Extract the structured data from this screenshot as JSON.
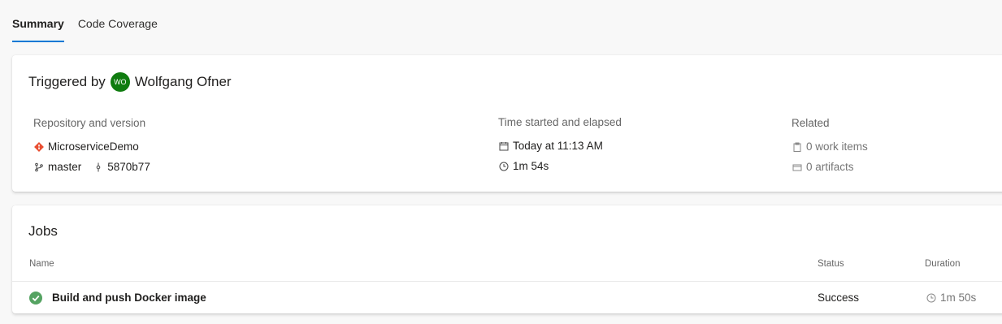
{
  "tabs": [
    {
      "label": "Summary",
      "active": true
    },
    {
      "label": "Code Coverage",
      "active": false
    }
  ],
  "summary": {
    "triggered_by_label": "Triggered by",
    "user_initials": "WO",
    "user_name": "Wolfgang Ofner",
    "avatar_color": "#107c10",
    "repo": {
      "header": "Repository and version",
      "repo_name": "MicroserviceDemo",
      "branch": "master",
      "commit": "5870b77"
    },
    "time": {
      "header": "Time started and elapsed",
      "started": "Today at 11:13 AM",
      "elapsed": "1m 54s"
    },
    "related": {
      "header": "Related",
      "work_items": "0 work items",
      "artifacts": "0 artifacts"
    }
  },
  "jobs": {
    "title": "Jobs",
    "columns": {
      "name": "Name",
      "status": "Status",
      "duration": "Duration"
    },
    "rows": [
      {
        "name": "Build and push Docker image",
        "status": "Success",
        "duration": "1m 50s",
        "status_color": "#55a362"
      }
    ]
  },
  "accent_color": "#0078d4"
}
